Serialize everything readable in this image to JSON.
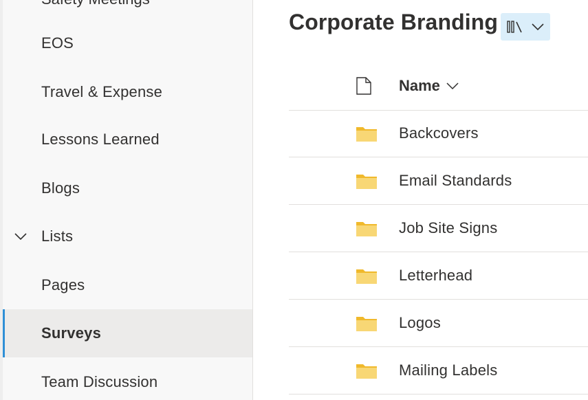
{
  "sidebar": {
    "cut_item": "Safety Meetings",
    "items": [
      {
        "label": "EOS",
        "selected": false
      },
      {
        "label": "Travel & Expense",
        "selected": false
      },
      {
        "label": "Lessons Learned",
        "selected": false
      },
      {
        "label": "Blogs",
        "selected": false
      },
      {
        "label": "Lists",
        "selected": false,
        "expandable": true,
        "expanded": true
      },
      {
        "label": "Pages",
        "selected": false
      },
      {
        "label": "Surveys",
        "selected": true
      },
      {
        "label": "Team Discussion",
        "selected": false
      }
    ],
    "accent_color": "#2f8fd6"
  },
  "main": {
    "title": "Corporate Branding",
    "view_switcher_icon": "library-icon",
    "columns": {
      "file_type_icon": "document-icon",
      "name": "Name"
    },
    "files": [
      {
        "name": "Backcovers",
        "type": "folder"
      },
      {
        "name": "Email Standards",
        "type": "folder"
      },
      {
        "name": "Job Site Signs",
        "type": "folder"
      },
      {
        "name": "Letterhead",
        "type": "folder"
      },
      {
        "name": "Logos",
        "type": "folder"
      },
      {
        "name": "Mailing Labels",
        "type": "folder"
      }
    ],
    "folder_color": "#f8d775"
  }
}
